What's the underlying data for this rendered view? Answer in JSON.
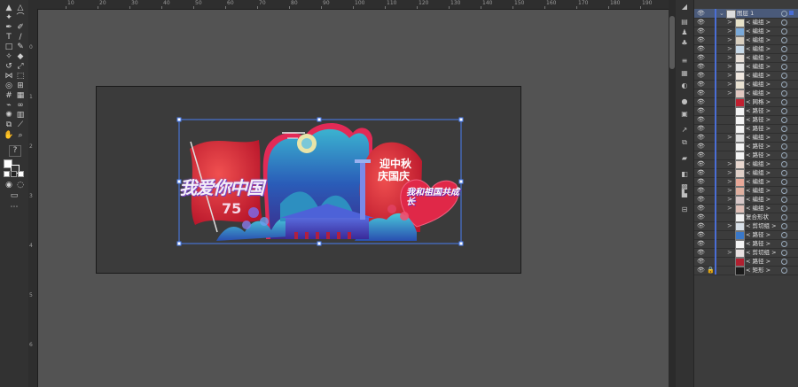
{
  "ruler": {
    "top_labels": [
      "10",
      "20",
      "30",
      "40",
      "50",
      "60",
      "70",
      "80",
      "90",
      "100",
      "110",
      "120",
      "130",
      "140",
      "150",
      "160",
      "170",
      "180",
      "190"
    ],
    "left_labels": [
      "0",
      "1",
      "2",
      "3",
      "4",
      "5",
      "6"
    ]
  },
  "artwork": {
    "title": "我爱你中国",
    "number": "75",
    "headline_line1": "迎中秋",
    "headline_line2": "庆国庆",
    "slogan": "我和祖国共成长"
  },
  "layers_panel": {
    "root_layer": "图层 1",
    "items": [
      {
        "label": "< 编组 >",
        "arrow": ">",
        "thumb": "#e7e2c8"
      },
      {
        "label": "< 编组 >",
        "arrow": ">",
        "thumb": "#7aa9d8"
      },
      {
        "label": "< 编组 >",
        "arrow": ">",
        "thumb": "#d9d0c0"
      },
      {
        "label": "< 编组 >",
        "arrow": ">",
        "thumb": "#c7d9e8"
      },
      {
        "label": "< 编组 >",
        "arrow": ">",
        "thumb": "#e8e0d8"
      },
      {
        "label": "< 编组 >",
        "arrow": ">",
        "thumb": "#e4e4e4"
      },
      {
        "label": "< 编组 >",
        "arrow": ">",
        "thumb": "#f0e8e0"
      },
      {
        "label": "< 编组 >",
        "arrow": ">",
        "thumb": "#e9e2d2"
      },
      {
        "label": "< 编组 >",
        "arrow": ">",
        "thumb": "#e0c8c0"
      },
      {
        "label": "< 网格 >",
        "arrow": "",
        "thumb": "#c02030"
      },
      {
        "label": "< 路径 >",
        "arrow": "",
        "thumb": "#f4f4f4"
      },
      {
        "label": "< 路径 >",
        "arrow": "",
        "thumb": "#f4f4f4"
      },
      {
        "label": "< 路径 >",
        "arrow": "",
        "thumb": "#f4f4f4"
      },
      {
        "label": "< 编组 >",
        "arrow": ">",
        "thumb": "#e0e0e0"
      },
      {
        "label": "< 路径 >",
        "arrow": "",
        "thumb": "#f4f4f4"
      },
      {
        "label": "< 路径 >",
        "arrow": "",
        "thumb": "#f4f4f4"
      },
      {
        "label": "< 编组 >",
        "arrow": ">",
        "thumb": "#e8d8d0"
      },
      {
        "label": "< 编组 >",
        "arrow": ">",
        "thumb": "#e0d0c8"
      },
      {
        "label": "< 编组 >",
        "arrow": ">",
        "thumb": "#e8a898"
      },
      {
        "label": "< 编组 >",
        "arrow": ">",
        "thumb": "#e0b0a0"
      },
      {
        "label": "< 编组 >",
        "arrow": ">",
        "thumb": "#d8c8c8"
      },
      {
        "label": "< 编组 >",
        "arrow": ">",
        "thumb": "#e0c0b8"
      },
      {
        "label": "复合形状",
        "arrow": "",
        "thumb": "#f4f4f4"
      },
      {
        "label": "< 剪切组 >",
        "arrow": ">",
        "thumb": "#d8e0e8"
      },
      {
        "label": "< 路径 >",
        "arrow": "",
        "thumb": "#3a78c8"
      },
      {
        "label": "< 路径 >",
        "arrow": "",
        "thumb": "#f4f4f4"
      },
      {
        "label": "< 剪切组 >",
        "arrow": ">",
        "thumb": "#e8e0e0"
      },
      {
        "label": "< 路径 >",
        "arrow": "",
        "thumb": "#b02030"
      },
      {
        "label": "< 矩形 >",
        "arrow": "",
        "thumb": "#1a1a1a"
      }
    ]
  }
}
